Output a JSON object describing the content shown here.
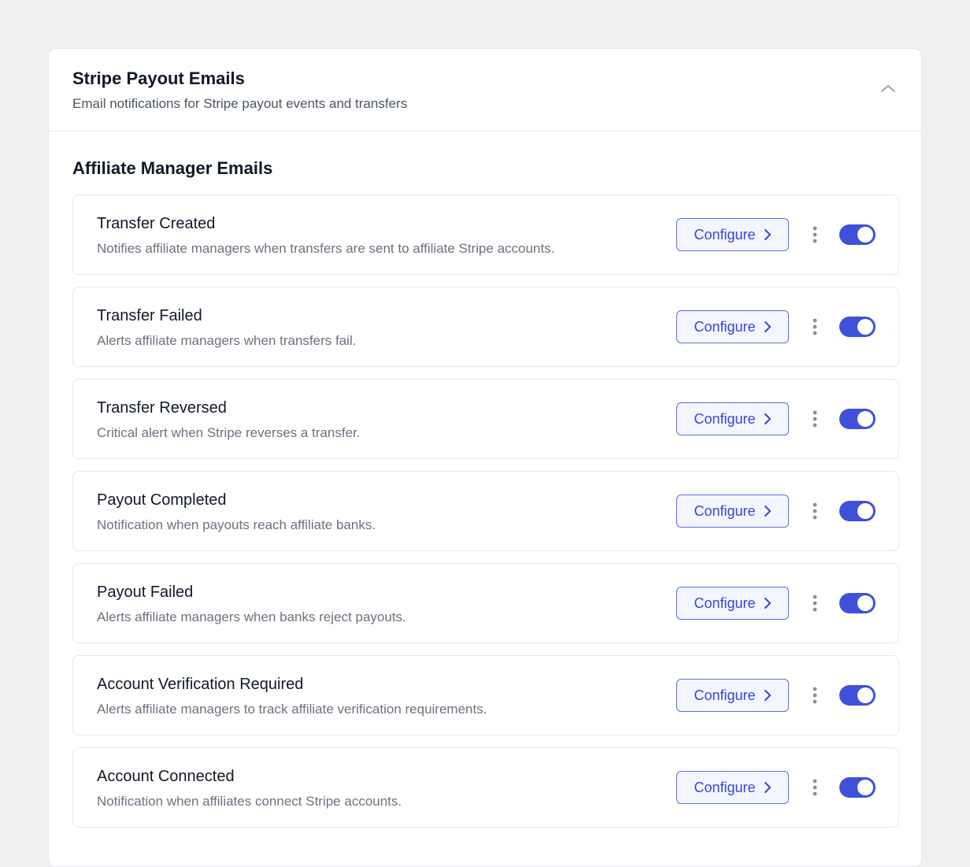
{
  "panel": {
    "title": "Stripe Payout Emails",
    "subtitle": "Email notifications for Stripe payout events and transfers",
    "collapse_icon": "chevron-up-icon"
  },
  "section": {
    "title": "Affiliate Manager Emails"
  },
  "accent_color": "#3f51d9",
  "items": [
    {
      "title": "Transfer Created",
      "description": "Notifies affiliate managers when transfers are sent to affiliate Stripe accounts.",
      "configure_label": "Configure",
      "enabled": true
    },
    {
      "title": "Transfer Failed",
      "description": "Alerts affiliate managers when transfers fail.",
      "configure_label": "Configure",
      "enabled": true
    },
    {
      "title": "Transfer Reversed",
      "description": "Critical alert when Stripe reverses a transfer.",
      "configure_label": "Configure",
      "enabled": true
    },
    {
      "title": "Payout Completed",
      "description": "Notification when payouts reach affiliate banks.",
      "configure_label": "Configure",
      "enabled": true
    },
    {
      "title": "Payout Failed",
      "description": "Alerts affiliate managers when banks reject payouts.",
      "configure_label": "Configure",
      "enabled": true
    },
    {
      "title": "Account Verification Required",
      "description": "Alerts affiliate managers to track affiliate verification requirements.",
      "configure_label": "Configure",
      "enabled": true
    },
    {
      "title": "Account Connected",
      "description": "Notification when affiliates connect Stripe accounts.",
      "configure_label": "Configure",
      "enabled": true
    }
  ]
}
